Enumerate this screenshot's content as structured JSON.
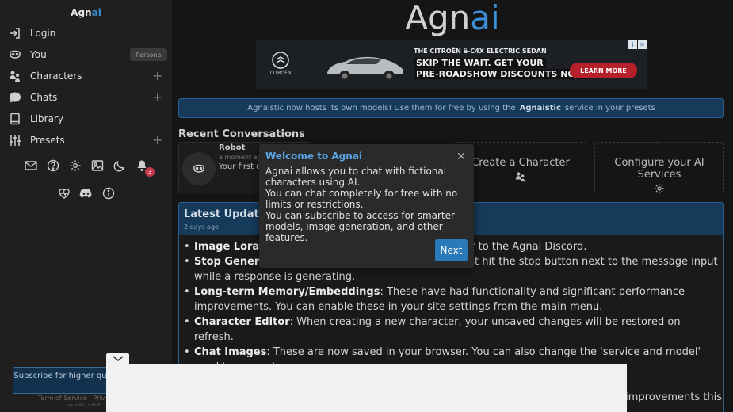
{
  "sidebar": {
    "brand_main": "Agn",
    "brand_accent": "ai",
    "items": [
      {
        "label": "Login",
        "icon": "login-icon"
      },
      {
        "label": "You",
        "icon": "mask-icon",
        "tag": "Persona"
      },
      {
        "label": "Characters",
        "icon": "characters-icon"
      },
      {
        "label": "Chats",
        "icon": "chat-bubble-icon"
      },
      {
        "label": "Library",
        "icon": "book-icon"
      },
      {
        "label": "Presets",
        "icon": "sliders-icon"
      }
    ],
    "notification_count": "3",
    "subscribe_text": "Subscribe for higher quality and no ads",
    "footer": "Term of Service · Priv",
    "version": "ver. ef8a / a f9a5"
  },
  "main": {
    "logo_main": "Agn",
    "logo_accent": "ai",
    "ad": {
      "brand": "CITROËN",
      "headline": "THE CITROËN ë-C4X ELECTRIC SEDAN",
      "line1": "SKIP THE WAIT. GET YOUR",
      "line2": "PRE-ROADSHOW DISCOUNTS NOW.",
      "cta": "LEARN MORE"
    },
    "banner_before": "Agnaistic now hosts its own models! Use them for free by using the",
    "banner_bold": "Agnaistic",
    "banner_after": "service in your presets",
    "recent_title": "Recent Conversations",
    "conversation": {
      "name": "Robot",
      "time": "a moment ago",
      "preview": "Your first co"
    },
    "create_character": "Create a Character",
    "configure_services": "Configure your AI Services",
    "updates": {
      "title": "Latest Updates",
      "date": "2 days ago",
      "items": [
        {
          "bold": "Image Loras",
          "text": ": I… you'd like to request one, head over to the Agnai Discord."
        },
        {
          "bold": "Stop Generation",
          "text": ": This feature is finally available. Just hit the stop button next to the message input while a response is generating."
        },
        {
          "bold": "Long-term Memory/Embeddings",
          "text": ": These have had functionality and significant performance improvements. You can enable these in your site settings from the main menu."
        },
        {
          "bold": "Character Editor",
          "text": ": When creating a new character, your unsaved changes will be restored on refresh."
        },
        {
          "bold": "Chat Images",
          "text": ": These are now saved in your browser. You can also change the 'service and model' used to generate"
        },
        {
          "bold": "",
          "text": "l improvements this"
        }
      ]
    }
  },
  "modal": {
    "title": "Welcome to Agnai",
    "body": [
      "Agnai allows you to chat with fictional characters using AI.",
      "You can chat completely for free with no limits or restrictions.",
      "You can subscribe to access for smarter models, image generation, and other features."
    ],
    "next_label": "Next"
  },
  "colors": {
    "accent": "#3a8fd6",
    "banner_bg": "#163a5a",
    "button": "#2a79b8"
  }
}
